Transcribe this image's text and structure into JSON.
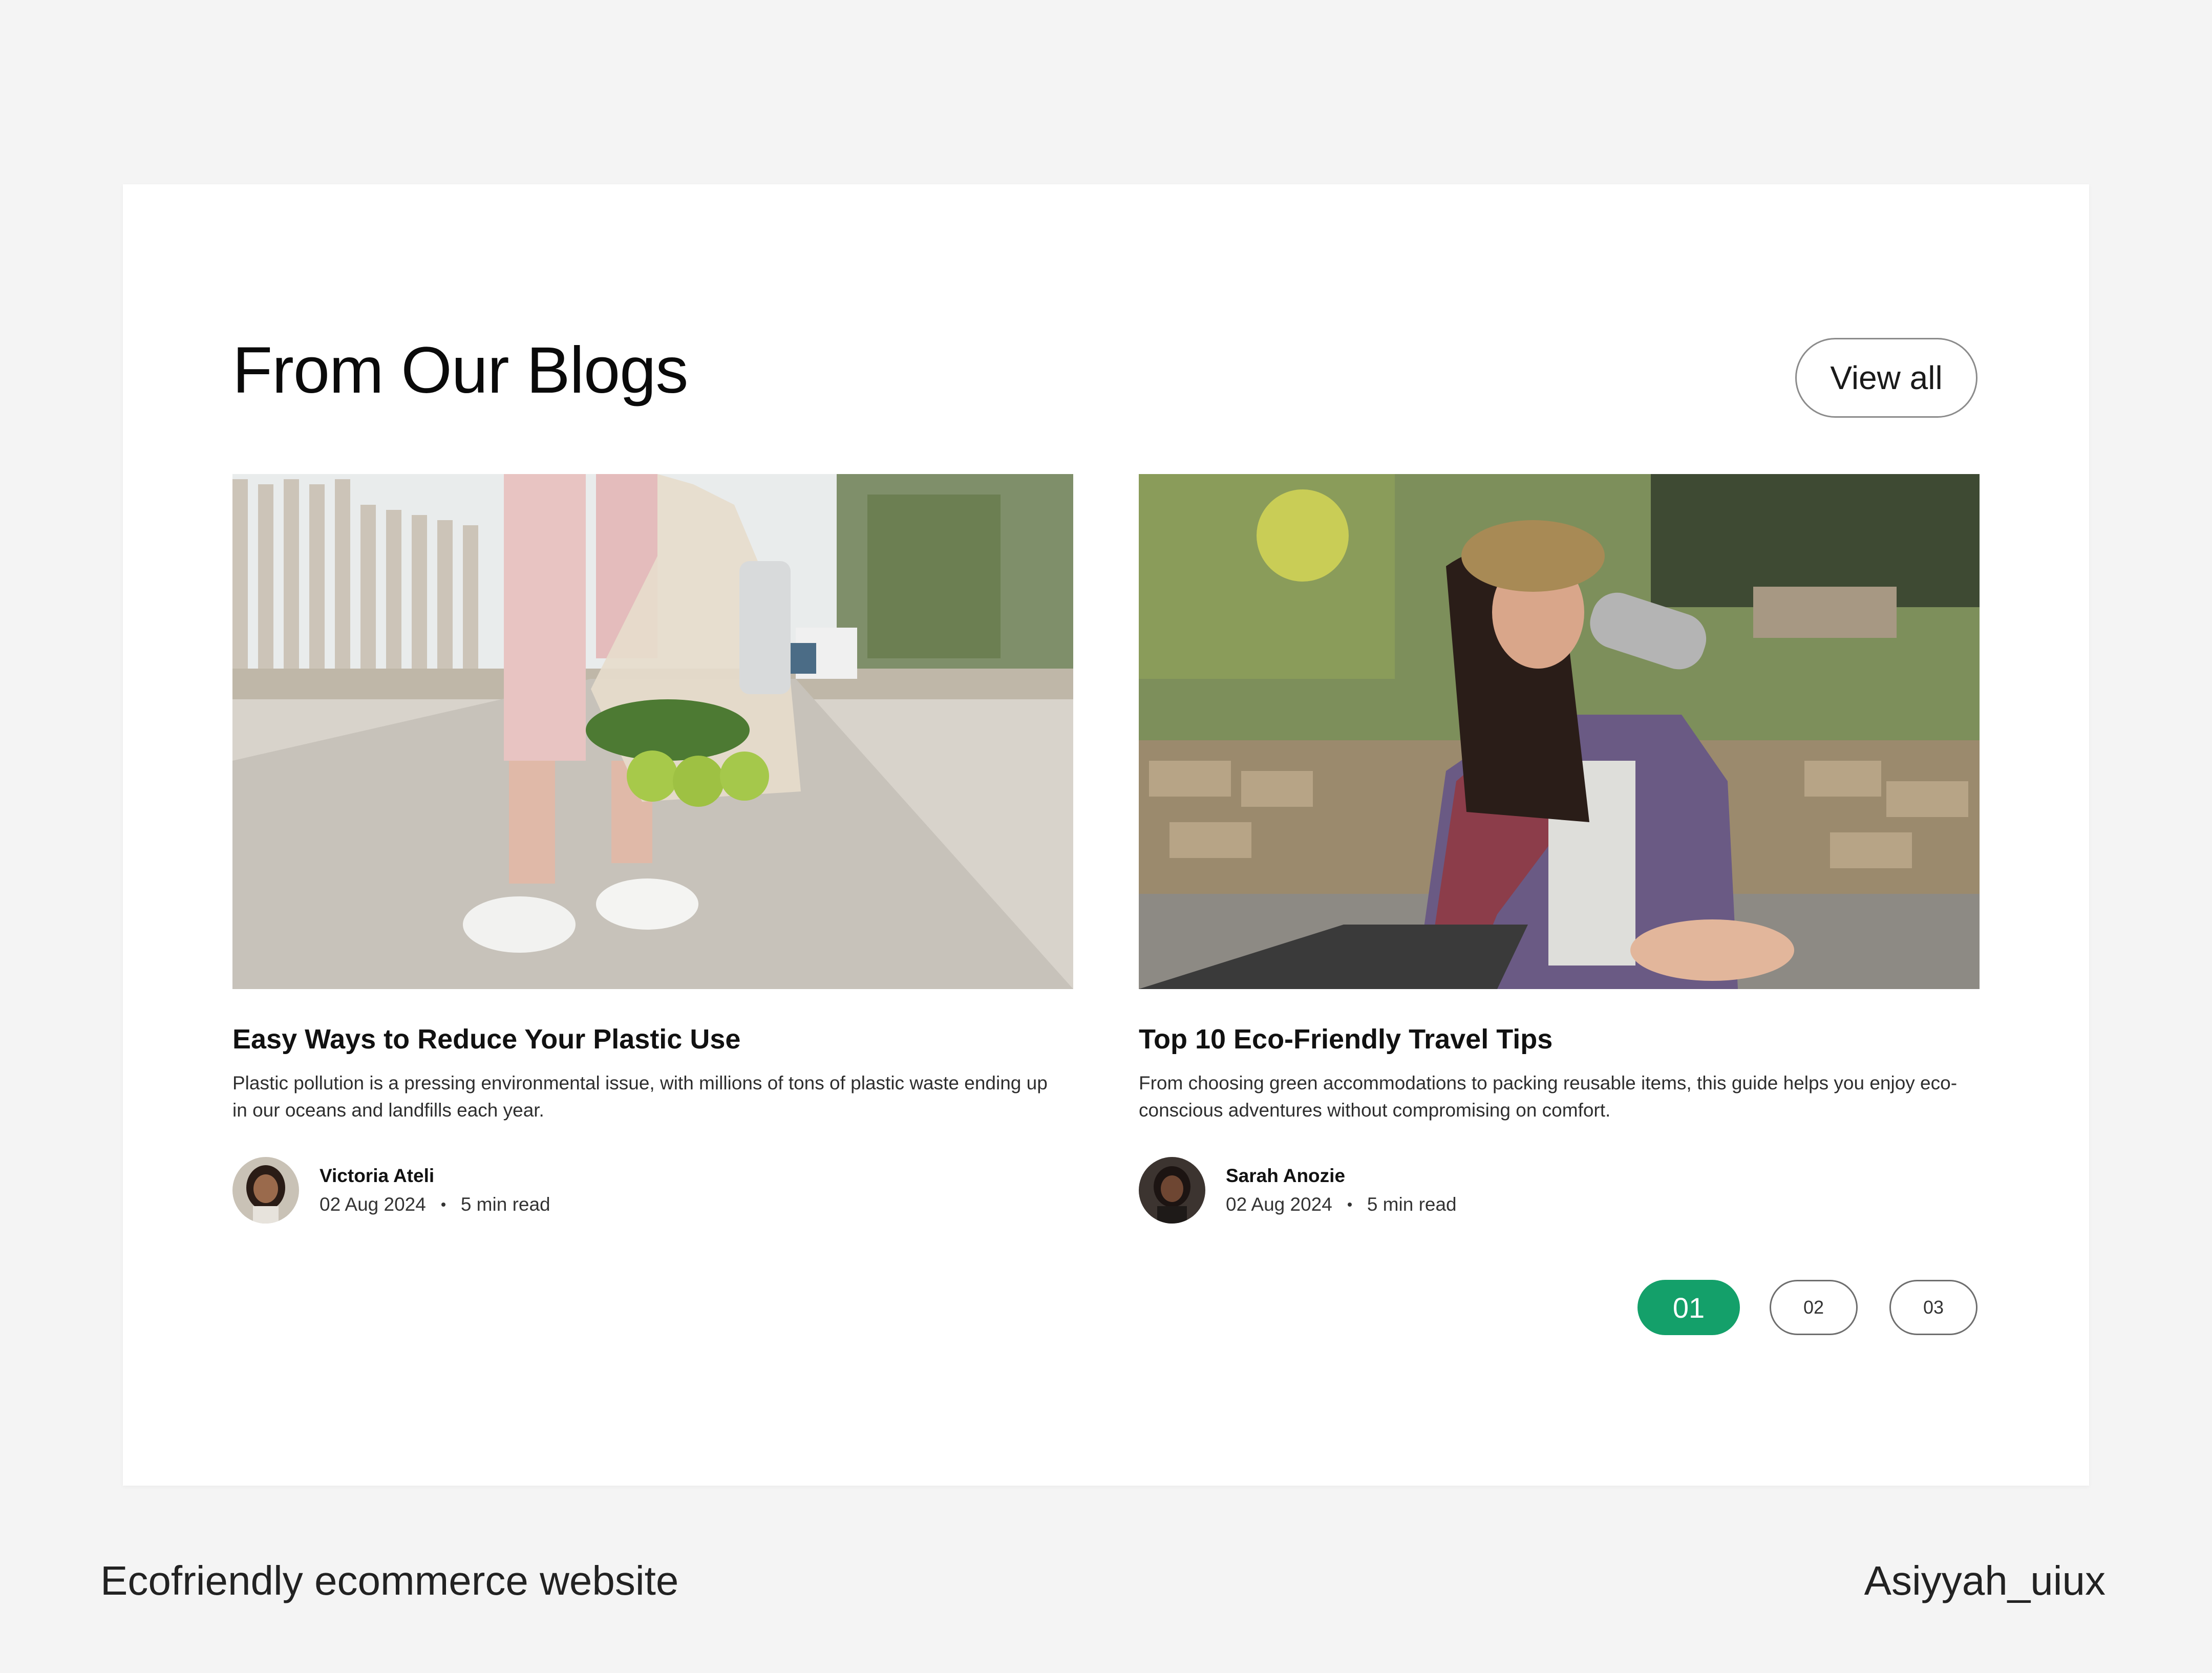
{
  "section": {
    "title": "From Our Blogs",
    "view_all_label": "View all"
  },
  "posts": [
    {
      "title": "Easy Ways to Reduce Your Plastic Use",
      "excerpt": "Plastic pollution is a pressing environmental issue, with millions of tons of plastic waste ending up in our oceans and landfills each year.",
      "author": "Victoria Ateli",
      "date": "02 Aug 2024",
      "read_time": "5 min read"
    },
    {
      "title": "Top 10 Eco-Friendly Travel Tips",
      "excerpt": "From choosing green accommodations to packing reusable items, this guide helps you enjoy eco-conscious adventures without compromising on comfort.",
      "author": "Sarah Anozie",
      "date": "02 Aug 2024",
      "read_time": "5 min read"
    }
  ],
  "pagination": [
    "01",
    "02",
    "03"
  ],
  "footer": {
    "left": "Ecofriendly ecommerce website",
    "right": "Asiyyah_uiux"
  },
  "colors": {
    "accent": "#14a06a",
    "background": "#f4f4f4",
    "card": "#ffffff"
  }
}
